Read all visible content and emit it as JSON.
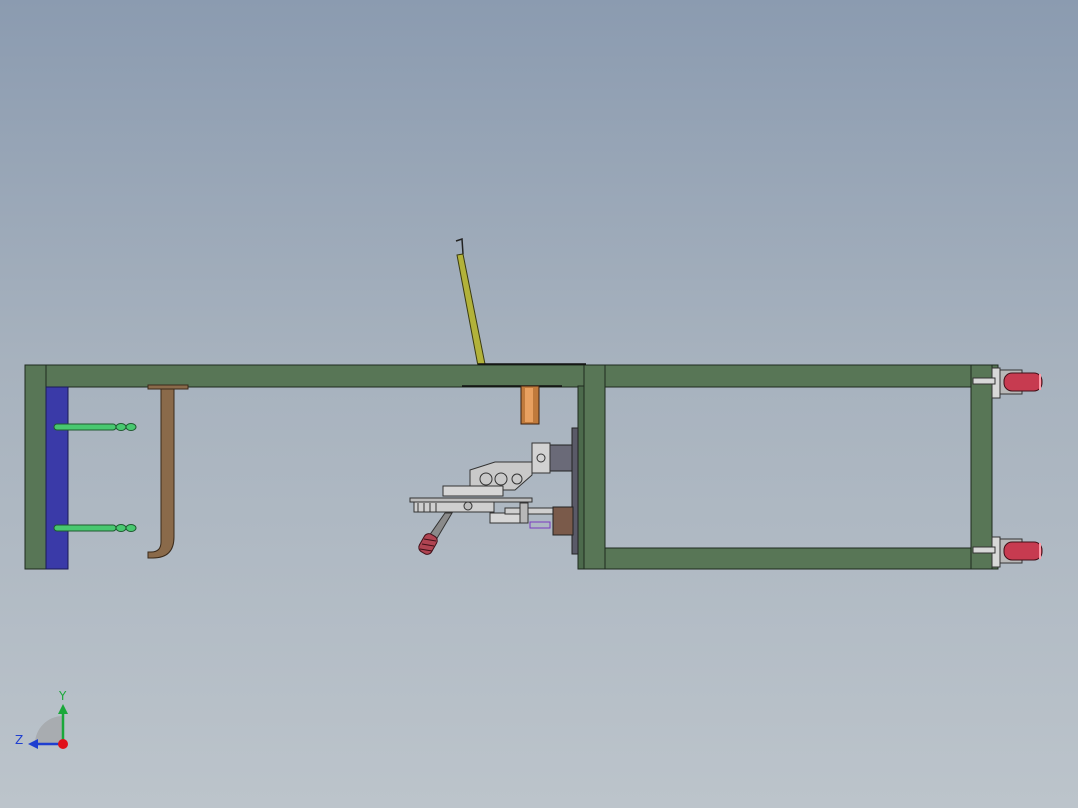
{
  "viewport": {
    "background_top": "#8b9bb0",
    "background_bottom": "#bcc4cb"
  },
  "model": {
    "frame_color": "#587656",
    "frame_edge_color": "#1e2a1e",
    "plate_color": "#3a3aa8",
    "pipe_color": "#8a6a4a",
    "rod_color": "#48c870",
    "lever_color": "#b2b23a",
    "bracket_color": "#c9c9c9",
    "handle_color": "#b04452",
    "cap_color": "#c73b50",
    "slider_color": "#6a6a78",
    "pad_color": "#c07a3c"
  },
  "triad": {
    "y_label": "Y",
    "z_label": "Z",
    "y_color": "#1aa83a",
    "z_color": "#1f3fd0",
    "x_color": "#e0101a"
  }
}
